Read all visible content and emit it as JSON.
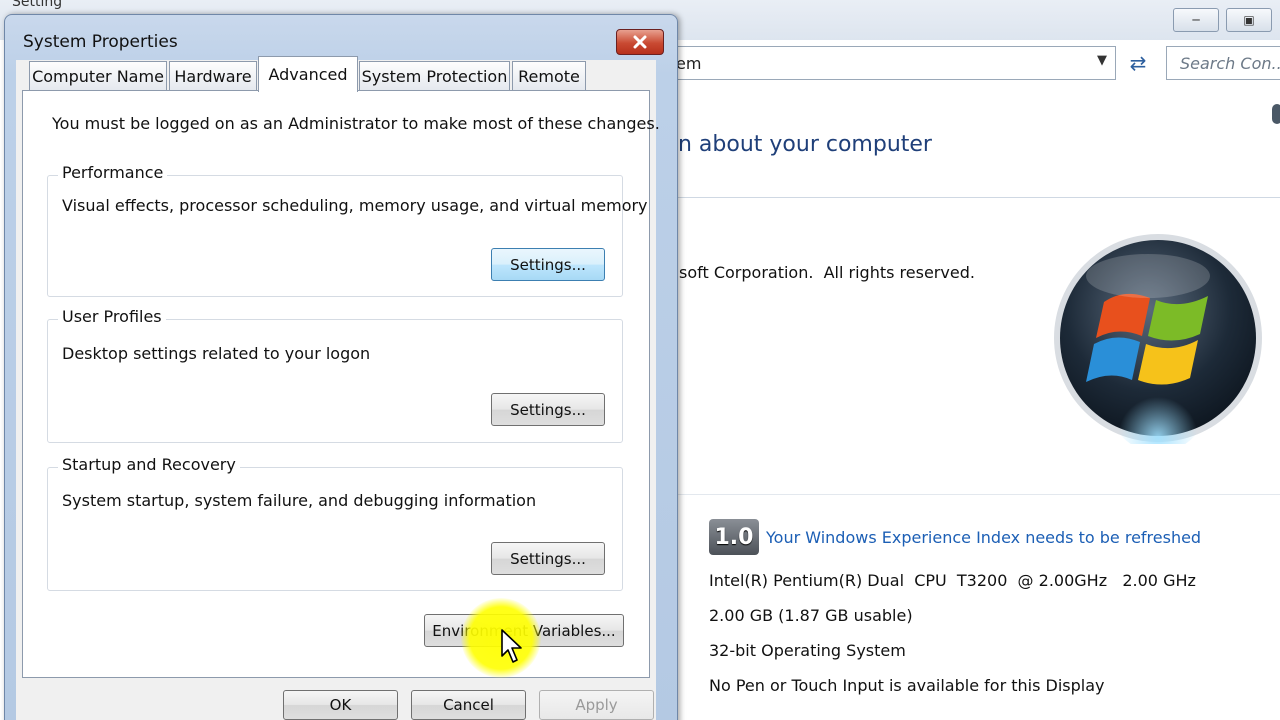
{
  "background_window": {
    "ghost_title": "Setting",
    "address_text": "em",
    "search_placeholder": "Search Con...",
    "heading": "n about your computer",
    "copyright": "soft Corporation.  All rights reserved.",
    "wei_score": "1.0",
    "wei_link": "Your Windows Experience Index needs to be refreshed",
    "specs": [
      "Intel(R) Pentium(R) Dual  CPU  T3200  @ 2.00GHz   2.00 GHz",
      "2.00 GB (1.87 GB usable)",
      "32-bit Operating System",
      "No Pen or Touch Input is available for this Display"
    ],
    "logo_icon": "windows-logo-icon"
  },
  "dialog": {
    "title": "System Properties",
    "tabs": [
      {
        "label": "Computer Name",
        "active": false
      },
      {
        "label": "Hardware",
        "active": false
      },
      {
        "label": "Advanced",
        "active": true
      },
      {
        "label": "System Protection",
        "active": false
      },
      {
        "label": "Remote",
        "active": false
      }
    ],
    "admin_note": "You must be logged on as an Administrator to make most of these changes.",
    "groups": [
      {
        "title": "Performance",
        "description": "Visual effects, processor scheduling, memory usage, and virtual memory",
        "button": "Settings..."
      },
      {
        "title": "User Profiles",
        "description": "Desktop settings related to your logon",
        "button": "Settings..."
      },
      {
        "title": "Startup and Recovery",
        "description": "System startup, system failure, and debugging information",
        "button": "Settings..."
      }
    ],
    "env_button": "Environment Variables...",
    "bottom_buttons": {
      "ok": "OK",
      "cancel": "Cancel",
      "apply": "Apply"
    }
  },
  "colors": {
    "link": "#1c5fb5",
    "heading": "#1f3f79",
    "close_button": "#c94a32",
    "cursor_highlight": "#ffff00"
  }
}
